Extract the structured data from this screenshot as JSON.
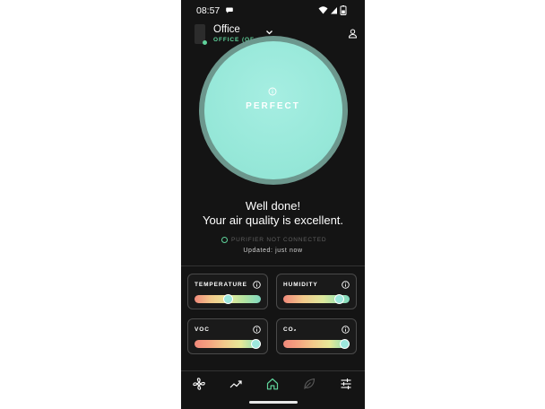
{
  "status_bar": {
    "time": "08:57",
    "icons": [
      "message-icon",
      "wifi-icon",
      "signal-icon",
      "battery-icon"
    ]
  },
  "header": {
    "room_name": "Office",
    "room_subtitle": "OFFICE (OF...",
    "icons": [
      "device-icon",
      "chevron-down-icon",
      "profile-icon"
    ]
  },
  "air_quality": {
    "rating": "PERFECT",
    "headline_1": "Well done!",
    "headline_2": "Your air quality is excellent.",
    "purifier_status": "PURIFIER NOT CONNECTED",
    "updated": "Updated: just now"
  },
  "metrics": [
    {
      "label": "TEMPERATURE",
      "level": 0.5
    },
    {
      "label": "HUMIDITY",
      "level": 0.85
    },
    {
      "label": "VOC",
      "level": 1.0
    },
    {
      "label": "CO₂",
      "level": 1.0
    }
  ],
  "nav": {
    "items": [
      "fan-icon",
      "trends-icon",
      "home-icon",
      "leaf-icon",
      "settings-icon"
    ],
    "active": "home-icon"
  },
  "colors": {
    "background": "#141414",
    "accent": "#5fd39b",
    "ring": "#6c978d",
    "dial": "#97e8d9"
  }
}
